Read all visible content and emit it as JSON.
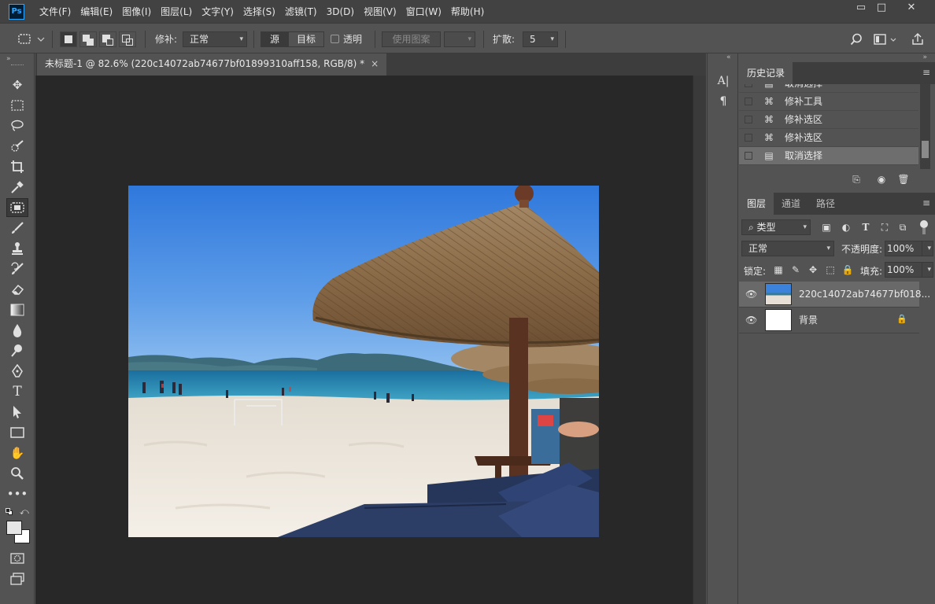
{
  "app": {
    "logo": "Ps",
    "menu": [
      "文件(F)",
      "编辑(E)",
      "图像(I)",
      "图层(L)",
      "文字(Y)",
      "选择(S)",
      "滤镜(T)",
      "3D(D)",
      "视图(V)",
      "窗口(W)",
      "帮助(H)"
    ],
    "window_buttons": {
      "minimize": "▭",
      "restore": "□",
      "close": "✕"
    }
  },
  "options": {
    "patch_label": "修补:",
    "patch_mode": "正常",
    "source_label": "源",
    "target_label": "目标",
    "transparent_label": "透明",
    "use_pattern_label": "使用图案",
    "diffusion_label": "扩散:",
    "diffusion_value": "5"
  },
  "document": {
    "tab_title": "未标题-1 @ 82.6% (220c14072ab74677bf01899310aff158, RGB/8) *",
    "close_glyph": "×"
  },
  "history": {
    "tab_label": "历史记录",
    "items": [
      {
        "label": "取消选择",
        "icon": "document-icon",
        "selected": false
      },
      {
        "label": "修补工具",
        "icon": "patch-icon",
        "selected": false
      },
      {
        "label": "修补选区",
        "icon": "patch-icon",
        "selected": false
      },
      {
        "label": "修补选区",
        "icon": "patch-icon",
        "selected": false
      },
      {
        "label": "取消选择",
        "icon": "document-icon",
        "selected": true
      }
    ]
  },
  "layers_panel": {
    "tabs": [
      "图层",
      "通道",
      "路径"
    ],
    "filter_kind": "类型",
    "blend_mode": "正常",
    "opacity_label": "不透明度:",
    "opacity_value": "100%",
    "lock_label": "锁定:",
    "fill_label": "填充:",
    "fill_value": "100%",
    "layers": [
      {
        "name": "220c14072ab74677bf018...",
        "selected": true,
        "locked": false
      },
      {
        "name": "背景",
        "selected": false,
        "locked": true
      }
    ]
  },
  "colors": {
    "accent": "#31a8ff",
    "panel": "#535353",
    "canvas_bg": "#282828"
  }
}
